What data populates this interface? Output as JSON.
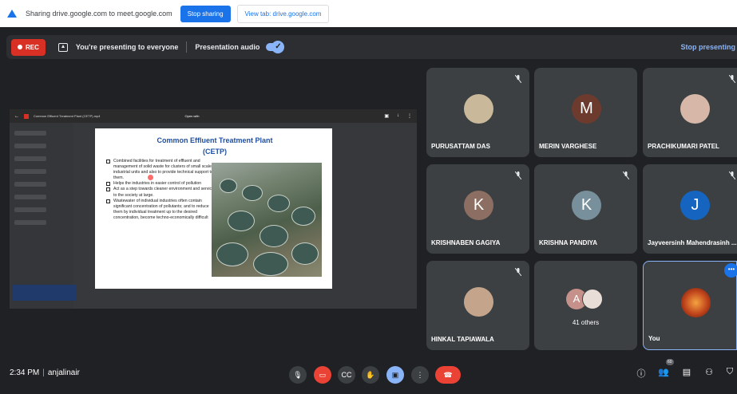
{
  "share_bar": {
    "sharing_text": "Sharing drive.google.com to meet.google.com",
    "stop_sharing": "Stop sharing",
    "view_tab": "View tab: drive.google.com"
  },
  "top_bar": {
    "rec": "REC",
    "presenting": "You're presenting to everyone",
    "presentation_audio": "Presentation audio",
    "stop_presenting": "Stop presenting"
  },
  "slide_viewer": {
    "file_name": "Common Effluent Treatment Plant (CETP).mp4",
    "open_with": "Open with"
  },
  "slide": {
    "title_line1": "Common Effluent Treatment Plant",
    "title_line2": "(CETP)",
    "bullets": [
      "Combined facilities for treatment of effluent and management of solid waste for clusters of small scale industrial units and also to provide technical support to them.",
      "Helps the industries in easier control of pollution",
      "Act as a step towards cleaner environment and service to the society at large.",
      "Wastewater of individual industries often contain significant concentration of pollutants; and to reduce them by individual treatment up to the desired concentration, become techno-economically difficult"
    ]
  },
  "participants": [
    {
      "name": "PURUSATTAM DAS",
      "initial": "",
      "color": "#c9b89a"
    },
    {
      "name": "MERIN VARGHESE",
      "initial": "M",
      "color": "#6d3b2e"
    },
    {
      "name": "PRACHIKUMARI PATEL",
      "initial": "",
      "color": "#d7b7a8"
    },
    {
      "name": "KRISHNABEN GAGIYA",
      "initial": "K",
      "color": "#8d6e63"
    },
    {
      "name": "KRISHNA PANDIYA",
      "initial": "K",
      "color": "#78909c"
    },
    {
      "name": "Jayveersinh Mahendrasinh ...",
      "initial": "J",
      "color": "#1565c0"
    },
    {
      "name": "HINKAL TAPIAWALA",
      "initial": "",
      "color": "#c4a58c"
    }
  ],
  "others": {
    "initial": "A",
    "label": "41 others"
  },
  "self_tile": {
    "name": "You"
  },
  "bottom_bar": {
    "time": "2:34 PM",
    "meeting_code": "anjalinair",
    "people_count": "60"
  }
}
